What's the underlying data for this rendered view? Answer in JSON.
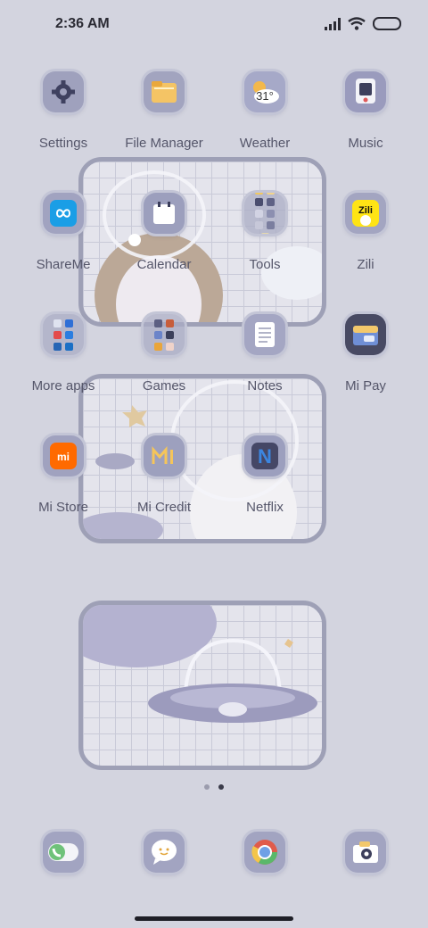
{
  "status_bar": {
    "time": "2:36 AM"
  },
  "apps": [
    {
      "id": "settings",
      "label": "Settings",
      "icon": "gear-icon"
    },
    {
      "id": "file-manager",
      "label": "File Manager",
      "icon": "folder-icon"
    },
    {
      "id": "weather",
      "label": "Weather",
      "icon": "weather-sun-cloud-icon",
      "badge": "31°"
    },
    {
      "id": "music",
      "label": "Music",
      "icon": "music-player-icon"
    },
    {
      "id": "shareme",
      "label": "ShareMe",
      "icon": "infinity-icon"
    },
    {
      "id": "calendar",
      "label": "Calendar",
      "icon": "calendar-icon"
    },
    {
      "id": "tools",
      "label": "Tools",
      "icon": "folder-grid-icon"
    },
    {
      "id": "zili",
      "label": "Zili",
      "icon": "zili-icon",
      "badge": "Zili"
    },
    {
      "id": "more-apps",
      "label": "More apps",
      "icon": "folder-grid-icon"
    },
    {
      "id": "games",
      "label": "Games",
      "icon": "folder-grid-icon"
    },
    {
      "id": "notes",
      "label": "Notes",
      "icon": "notes-icon"
    },
    {
      "id": "mi-pay",
      "label": "Mi Pay",
      "icon": "wallet-icon"
    },
    {
      "id": "mi-store",
      "label": "Mi Store",
      "icon": "mi-logo-icon",
      "badge": "mi"
    },
    {
      "id": "mi-credit",
      "label": "Mi Credit",
      "icon": "mi-credit-icon"
    },
    {
      "id": "netflix",
      "label": "Netflix",
      "icon": "netflix-icon",
      "badge": "N"
    }
  ],
  "dock": [
    {
      "id": "phone",
      "icon": "phone-icon"
    },
    {
      "id": "messages",
      "icon": "message-bubble-icon"
    },
    {
      "id": "browser",
      "icon": "browser-icon"
    },
    {
      "id": "camera",
      "icon": "camera-icon"
    }
  ],
  "pages": {
    "count": 2,
    "current": 2
  },
  "colors": {
    "background": "#d3d4df",
    "widget_border": "#9ea0b6",
    "icon_tile": "#9ea1bb"
  }
}
